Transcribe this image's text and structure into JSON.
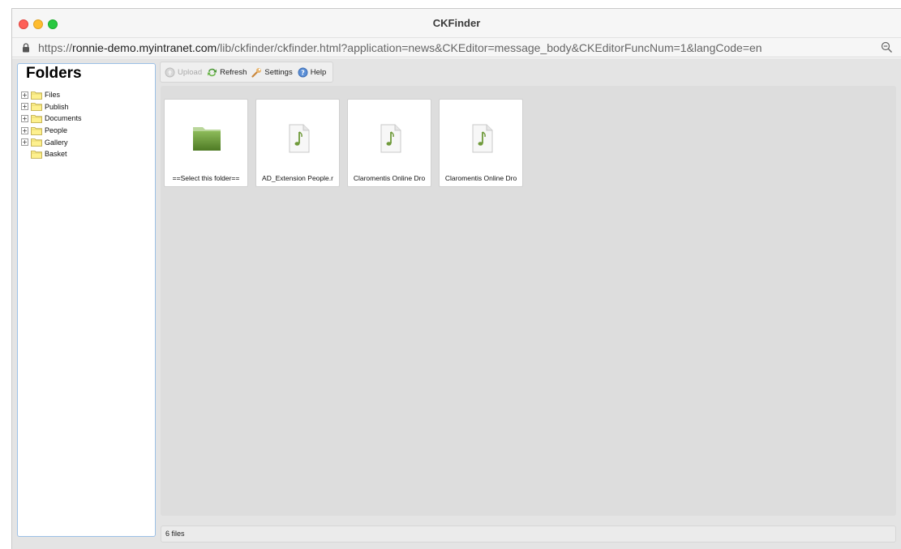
{
  "window": {
    "title": "CKFinder"
  },
  "url": {
    "prefix": "https://",
    "host": "ronnie-demo.myintranet.com",
    "path": "/lib/ckfinder/ckfinder.html?application=news&CKEditor=message_body&CKEditorFuncNum=1&langCode=en"
  },
  "sidebar": {
    "title": "Folders",
    "folders": [
      {
        "label": "Files",
        "expandable": true
      },
      {
        "label": "Publish",
        "expandable": true
      },
      {
        "label": "Documents",
        "expandable": true
      },
      {
        "label": "People",
        "expandable": true
      },
      {
        "label": "Gallery",
        "expandable": true
      },
      {
        "label": "Basket",
        "expandable": false
      }
    ],
    "expander_glyph": "+"
  },
  "toolbar": {
    "upload_label": "Upload",
    "refresh_label": "Refresh",
    "settings_label": "Settings",
    "help_label": "Help"
  },
  "files": [
    {
      "caption": "==Select this folder==",
      "icon": "folder-icon"
    },
    {
      "caption": "AD_Extension People.r",
      "icon": "audio-file-icon"
    },
    {
      "caption": "Claromentis Online Dro",
      "icon": "audio-file-icon"
    },
    {
      "caption": "Claromentis Online Dro",
      "icon": "audio-file-icon"
    }
  ],
  "status": {
    "text": "6 files"
  },
  "colors": {
    "sidebar_border": "#9cc0e6",
    "folder_green": "#5e8a2e",
    "note_green": "#6f9a3a"
  }
}
